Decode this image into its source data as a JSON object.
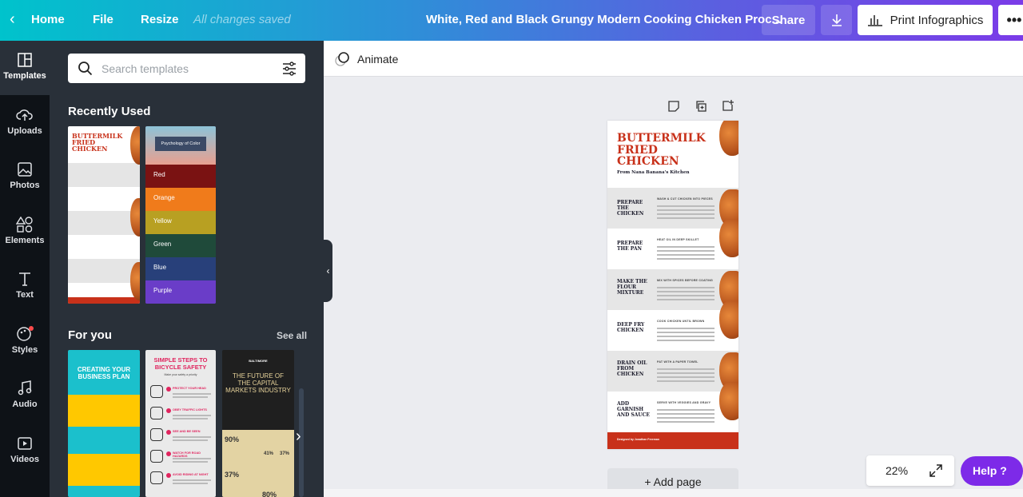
{
  "topbar": {
    "home": "Home",
    "file": "File",
    "resize": "Resize",
    "status": "All changes saved",
    "title": "White, Red and Black Grungy Modern Cooking Chicken Proc...",
    "share": "Share",
    "print": "Print Infographics"
  },
  "rail": [
    {
      "label": "Templates",
      "icon": "templates-icon"
    },
    {
      "label": "Uploads",
      "icon": "upload-cloud-icon"
    },
    {
      "label": "Photos",
      "icon": "photo-icon"
    },
    {
      "label": "Elements",
      "icon": "shapes-icon"
    },
    {
      "label": "Text",
      "icon": "text-icon"
    },
    {
      "label": "Styles",
      "icon": "palette-icon"
    },
    {
      "label": "Audio",
      "icon": "music-note-icon"
    },
    {
      "label": "Videos",
      "icon": "video-icon"
    }
  ],
  "panel": {
    "search_placeholder": "Search templates",
    "recent": "Recently Used",
    "foryou": "For you",
    "see_all": "See all",
    "recent_templates": [
      {
        "title": "BUTTERMILK FRIED CHICKEN"
      },
      {
        "title": "Psychology of Color",
        "rows": [
          "Red",
          "Orange",
          "Yellow",
          "Green",
          "Blue",
          "Purple"
        ]
      }
    ],
    "foryou_templates": [
      {
        "title": "CREATING YOUR BUSINESS PLAN"
      },
      {
        "title": "SIMPLE STEPS TO BICYCLE SAFETY",
        "subtitle": "Make your safety a priority",
        "items": [
          "PROTECT YOUR HEAD",
          "OBEY TRAFFIC LIGHTS",
          "SEE AND BE SEEN",
          "WATCH FOR ROAD HAZARDS",
          "AVOID RIDING AT NIGHT"
        ]
      },
      {
        "title": "THE FUTURE OF THE CAPITAL MARKETS INDUSTRY",
        "brand": "BALTIMORE",
        "stats": [
          "90%",
          "41%",
          "37%",
          "37%",
          "80%"
        ]
      }
    ]
  },
  "canvas": {
    "animate": "Animate",
    "add_page": "+ Add page",
    "zoom": "22%",
    "help": "Help ?"
  },
  "design": {
    "title": "BUTTERMILK FRIED CHICKEN",
    "subtitle": "From Nana Banana's Kitchen",
    "footer": "Designed by Jonathan Freeman",
    "steps": [
      {
        "title": "PREPARE THE CHICKEN",
        "heading": "WASH & CUT CHICKEN INTO PIECES"
      },
      {
        "title": "PREPARE THE PAN",
        "heading": "HEAT OIL IN DEEP SKILLET"
      },
      {
        "title": "MAKE THE FLOUR MIXTURE",
        "heading": "MIX WITH SPICES BEFORE COATING"
      },
      {
        "title": "DEEP FRY CHICKEN",
        "heading": "COOK CHICKEN UNTIL BROWN"
      },
      {
        "title": "DRAIN OIL FROM CHICKEN",
        "heading": "PAT WITH A PAPER TOWEL"
      },
      {
        "title": "ADD GARNISH AND SAUCE",
        "heading": "SERVE WITH VEGGIES AND GRAVY"
      }
    ]
  },
  "colors": {
    "accent": "#c8311a",
    "help": "#7d2ae8",
    "panel": "#293039"
  }
}
